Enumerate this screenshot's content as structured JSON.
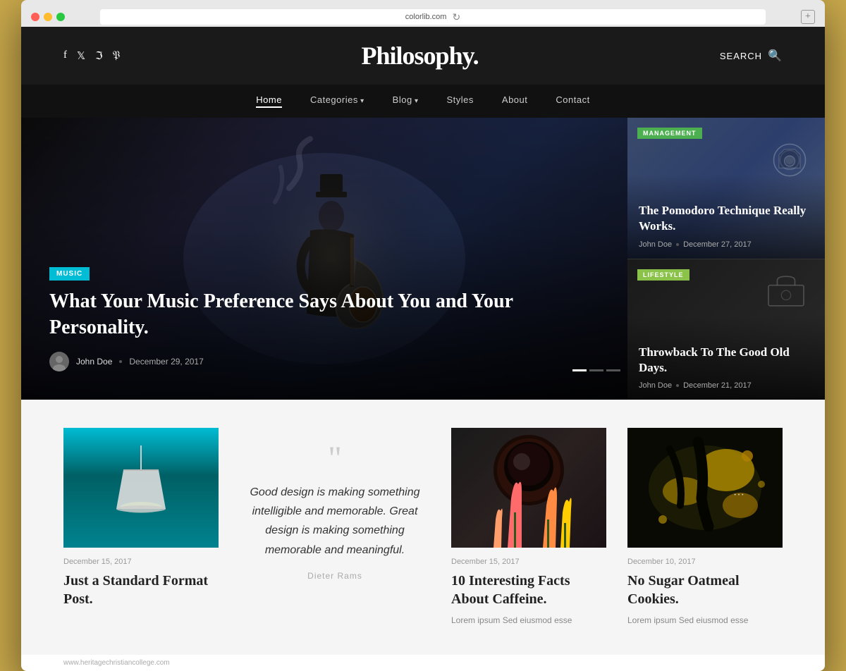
{
  "browser": {
    "address": "colorlib.com",
    "new_tab_label": "+",
    "dots": [
      "red",
      "yellow",
      "green"
    ]
  },
  "site": {
    "title": "Philosophy.",
    "search_label": "SEARCH",
    "social_icons": [
      "f",
      "𝕏",
      "📷",
      "𝕡"
    ]
  },
  "nav": {
    "items": [
      {
        "label": "Home",
        "active": true
      },
      {
        "label": "Categories",
        "has_arrow": true
      },
      {
        "label": "Blog",
        "has_arrow": true
      },
      {
        "label": "Styles"
      },
      {
        "label": "About"
      },
      {
        "label": "Contact"
      }
    ]
  },
  "hero": {
    "category_badge": "MUSIC",
    "title": "What Your Music Preference Says About You and Your Personality.",
    "author": "John Doe",
    "date": "December 29, 2017",
    "cards": [
      {
        "category": "MANAGEMENT",
        "category_class": "cat-management",
        "title": "The Pomodoro Technique Really Works.",
        "author": "John Doe",
        "date": "December 27, 2017"
      },
      {
        "category": "LIFESTYLE",
        "category_class": "cat-lifestyle",
        "title": "Throwback To The Good Old Days.",
        "author": "John Doe",
        "date": "December 21, 2017"
      }
    ]
  },
  "posts": [
    {
      "type": "image",
      "image_class": "post-img-lamp",
      "date": "December 15, 2017",
      "title": "Just a Standard Format Post.",
      "excerpt": ""
    },
    {
      "type": "quote",
      "quote": "Good design is making something intelligible and memorable. Great design is making something memorable and meaningful.",
      "author": "Dieter Rams"
    },
    {
      "type": "image",
      "image_class": "post-img-coffee",
      "date": "December 15, 2017",
      "title": "10 Interesting Facts About Caffeine.",
      "excerpt": "Lorem ipsum Sed eiusmod esse"
    },
    {
      "type": "image",
      "image_class": "post-img-cookies",
      "date": "December 10, 2017",
      "title": "No Sugar Oatmeal Cookies.",
      "excerpt": "Lorem ipsum Sed eiusmod esse"
    }
  ],
  "footer": {
    "url": "www.heritagechristiancollege.com"
  }
}
